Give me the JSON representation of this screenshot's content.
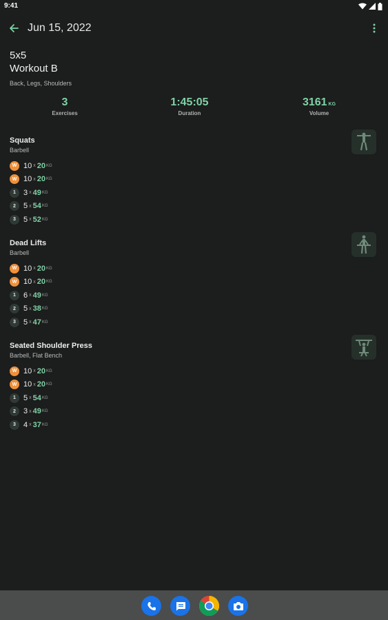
{
  "status_bar": {
    "time": "9:41"
  },
  "app_bar": {
    "title": "Jun 15, 2022"
  },
  "workout": {
    "routine": "5x5",
    "name": "Workout B",
    "muscles": "Back, Legs, Shoulders"
  },
  "stats": {
    "exercises": {
      "value": "3",
      "label": "Exercises"
    },
    "duration": {
      "value": "1:45:05",
      "label": "Duration"
    },
    "volume": {
      "value": "3161",
      "unit": "KG",
      "label": "Volume"
    }
  },
  "set_separator": "x",
  "weight_unit": "KG",
  "exercises": [
    {
      "name": "Squats",
      "equipment": "Barbell",
      "thumb_icon": "squat-figure-icon",
      "sets": [
        {
          "badge": "W",
          "type": "warmup",
          "reps": "10",
          "weight": "20"
        },
        {
          "badge": "W",
          "type": "warmup",
          "reps": "10",
          "weight": "20"
        },
        {
          "badge": "1",
          "type": "normal",
          "reps": "3",
          "weight": "49"
        },
        {
          "badge": "2",
          "type": "normal",
          "reps": "5",
          "weight": "54"
        },
        {
          "badge": "3",
          "type": "normal",
          "reps": "5",
          "weight": "52"
        }
      ]
    },
    {
      "name": "Dead Lifts",
      "equipment": "Barbell",
      "thumb_icon": "deadlift-figure-icon",
      "sets": [
        {
          "badge": "W",
          "type": "warmup",
          "reps": "10",
          "weight": "20"
        },
        {
          "badge": "W",
          "type": "warmup",
          "reps": "10",
          "weight": "20"
        },
        {
          "badge": "1",
          "type": "normal",
          "reps": "6",
          "weight": "49"
        },
        {
          "badge": "2",
          "type": "normal",
          "reps": "5",
          "weight": "38"
        },
        {
          "badge": "3",
          "type": "normal",
          "reps": "5",
          "weight": "47"
        }
      ]
    },
    {
      "name": "Seated Shoulder Press",
      "equipment": "Barbell, Flat Bench",
      "thumb_icon": "shoulder-press-figure-icon",
      "sets": [
        {
          "badge": "W",
          "type": "warmup",
          "reps": "10",
          "weight": "20"
        },
        {
          "badge": "W",
          "type": "warmup",
          "reps": "10",
          "weight": "20"
        },
        {
          "badge": "1",
          "type": "normal",
          "reps": "5",
          "weight": "54"
        },
        {
          "badge": "2",
          "type": "normal",
          "reps": "3",
          "weight": "49"
        },
        {
          "badge": "3",
          "type": "normal",
          "reps": "4",
          "weight": "37"
        }
      ]
    }
  ],
  "dock": {
    "apps": [
      {
        "name": "phone-app-icon",
        "color": "#1a73e8"
      },
      {
        "name": "messages-app-icon",
        "color": "#1a73e8"
      },
      {
        "name": "chrome-app-icon",
        "color": "#ffffff"
      },
      {
        "name": "camera-app-icon",
        "color": "#1a73e8"
      }
    ]
  },
  "colors": {
    "background": "#1c1d1d",
    "accent": "#7fd2a6",
    "warmup": "#f0913a",
    "dock": "#4b4c4c"
  }
}
